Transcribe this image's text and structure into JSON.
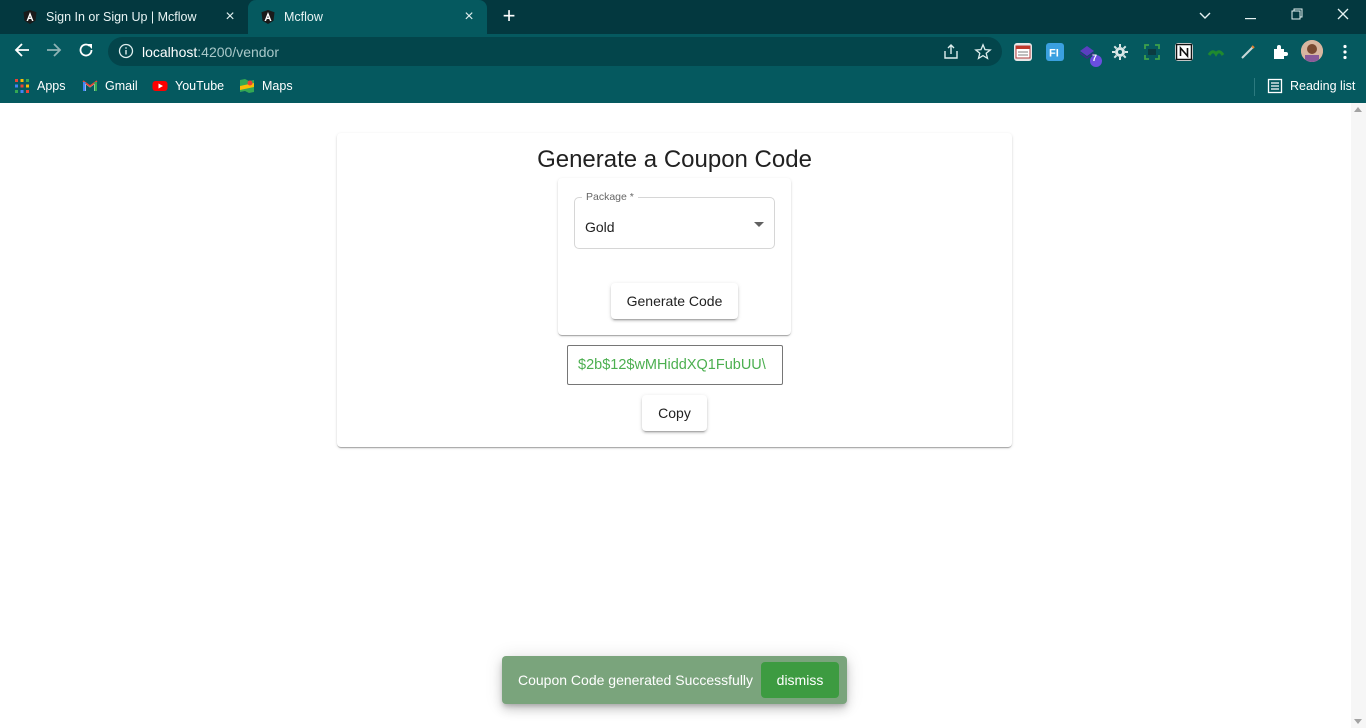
{
  "browser": {
    "tabs": [
      {
        "title": "Sign In or Sign Up | Mcflow",
        "icon": "angular-icon",
        "active": false
      },
      {
        "title": "Mcflow",
        "icon": "angular-icon",
        "active": true
      }
    ],
    "url_host": "localhost",
    "url_path": ":4200/vendor",
    "bookmarks": [
      {
        "label": "Apps",
        "icon": "apps-grid-icon"
      },
      {
        "label": "Gmail",
        "icon": "gmail-icon"
      },
      {
        "label": "YouTube",
        "icon": "youtube-icon"
      },
      {
        "label": "Maps",
        "icon": "maps-icon"
      }
    ],
    "reading_list": "Reading list",
    "extension_badge": "7"
  },
  "page": {
    "title": "Generate a Coupon Code",
    "package_field": {
      "label": "Package *",
      "value": "Gold"
    },
    "generate_button": "Generate Code",
    "coupon_code": "$2b$12$wMHiddXQ1FubUU\\",
    "copy_button": "Copy"
  },
  "snackbar": {
    "message": "Coupon Code generated Successfully",
    "action": "dismiss"
  },
  "colors": {
    "chrome_dark": "#03383f",
    "chrome": "#05595f",
    "code_text": "#4caf50",
    "snackbar_bg": "#7aa47c",
    "snackbar_action_bg": "#3d9b41"
  }
}
